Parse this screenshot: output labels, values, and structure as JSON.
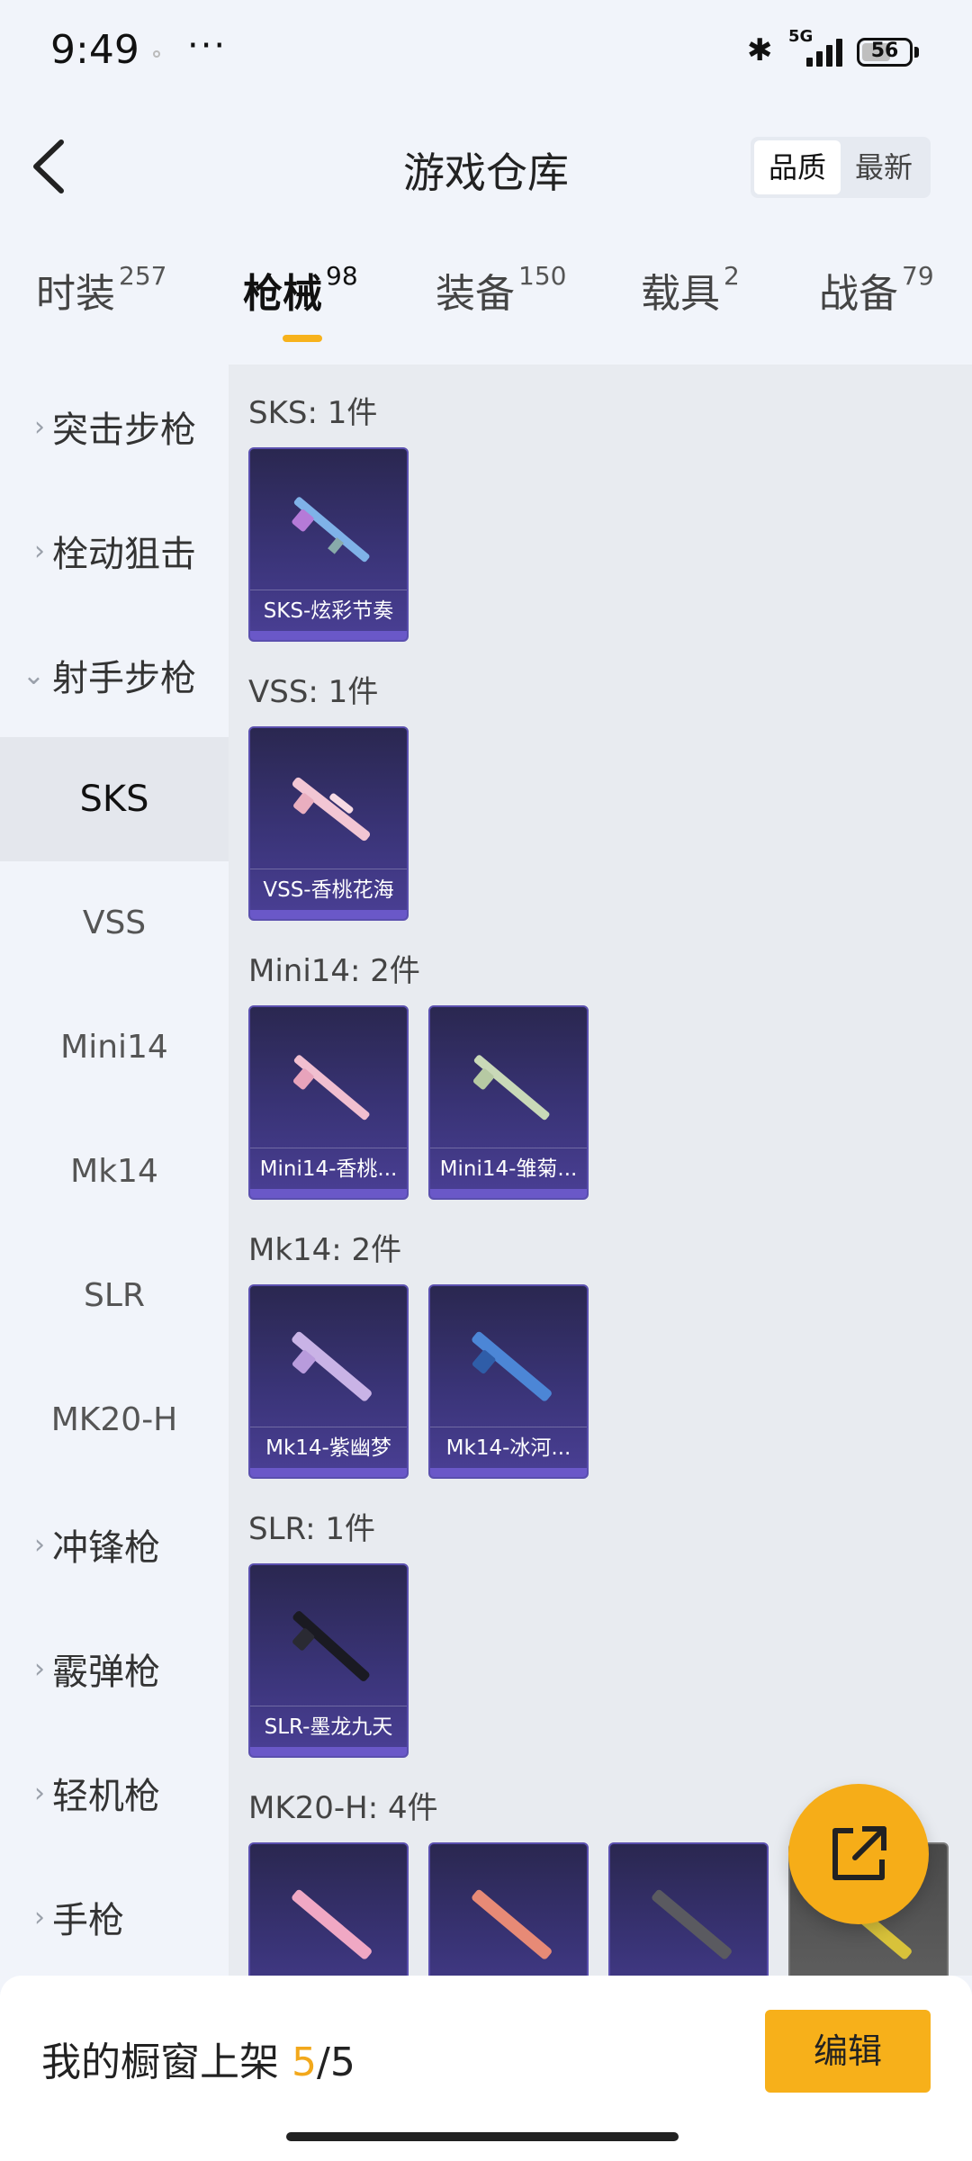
{
  "status": {
    "time": "9:49",
    "more": "···",
    "bluetooth": "✱",
    "network": "5G",
    "battery": "56"
  },
  "header": {
    "title": "游戏仓库",
    "sort_quality": "品质",
    "sort_newest": "最新"
  },
  "tabs": [
    {
      "label": "时装",
      "count": "257"
    },
    {
      "label": "枪械",
      "count": "98"
    },
    {
      "label": "装备",
      "count": "150"
    },
    {
      "label": "载具",
      "count": "2"
    },
    {
      "label": "战备",
      "count": "79"
    }
  ],
  "sidebar": {
    "top_groups": [
      "突击步枪",
      "栓动狙击",
      "射手步枪"
    ],
    "subs": [
      "SKS",
      "VSS",
      "Mini14",
      "Mk14",
      "SLR",
      "MK20-H"
    ],
    "bottom_groups": [
      "冲锋枪",
      "霰弹枪",
      "轻机枪",
      "手枪"
    ],
    "chevron_right": "›",
    "chevron_down": "⌄"
  },
  "groups": [
    {
      "title": "SKS: 1件",
      "items": [
        "SKS-炫彩节奏"
      ]
    },
    {
      "title": "VSS: 1件",
      "items": [
        "VSS-香桃花海"
      ]
    },
    {
      "title": "Mini14: 2件",
      "items": [
        "Mini14-香桃...",
        "Mini14-雏菊..."
      ]
    },
    {
      "title": "Mk14: 2件",
      "items": [
        "Mk14-紫幽梦",
        "Mk14-冰河..."
      ]
    },
    {
      "title": "SLR: 1件",
      "items": [
        "SLR-墨龙九天"
      ]
    },
    {
      "title": "MK20-H: 4件",
      "items": [
        "",
        "",
        "",
        ""
      ]
    }
  ],
  "bottom": {
    "label": "我的橱窗上架",
    "current": "5",
    "total": "/5",
    "edit": "编辑"
  },
  "colors": {
    "accent": "#f7b01a",
    "card_top": "#2a2750",
    "card_bottom": "#4a3f95"
  }
}
